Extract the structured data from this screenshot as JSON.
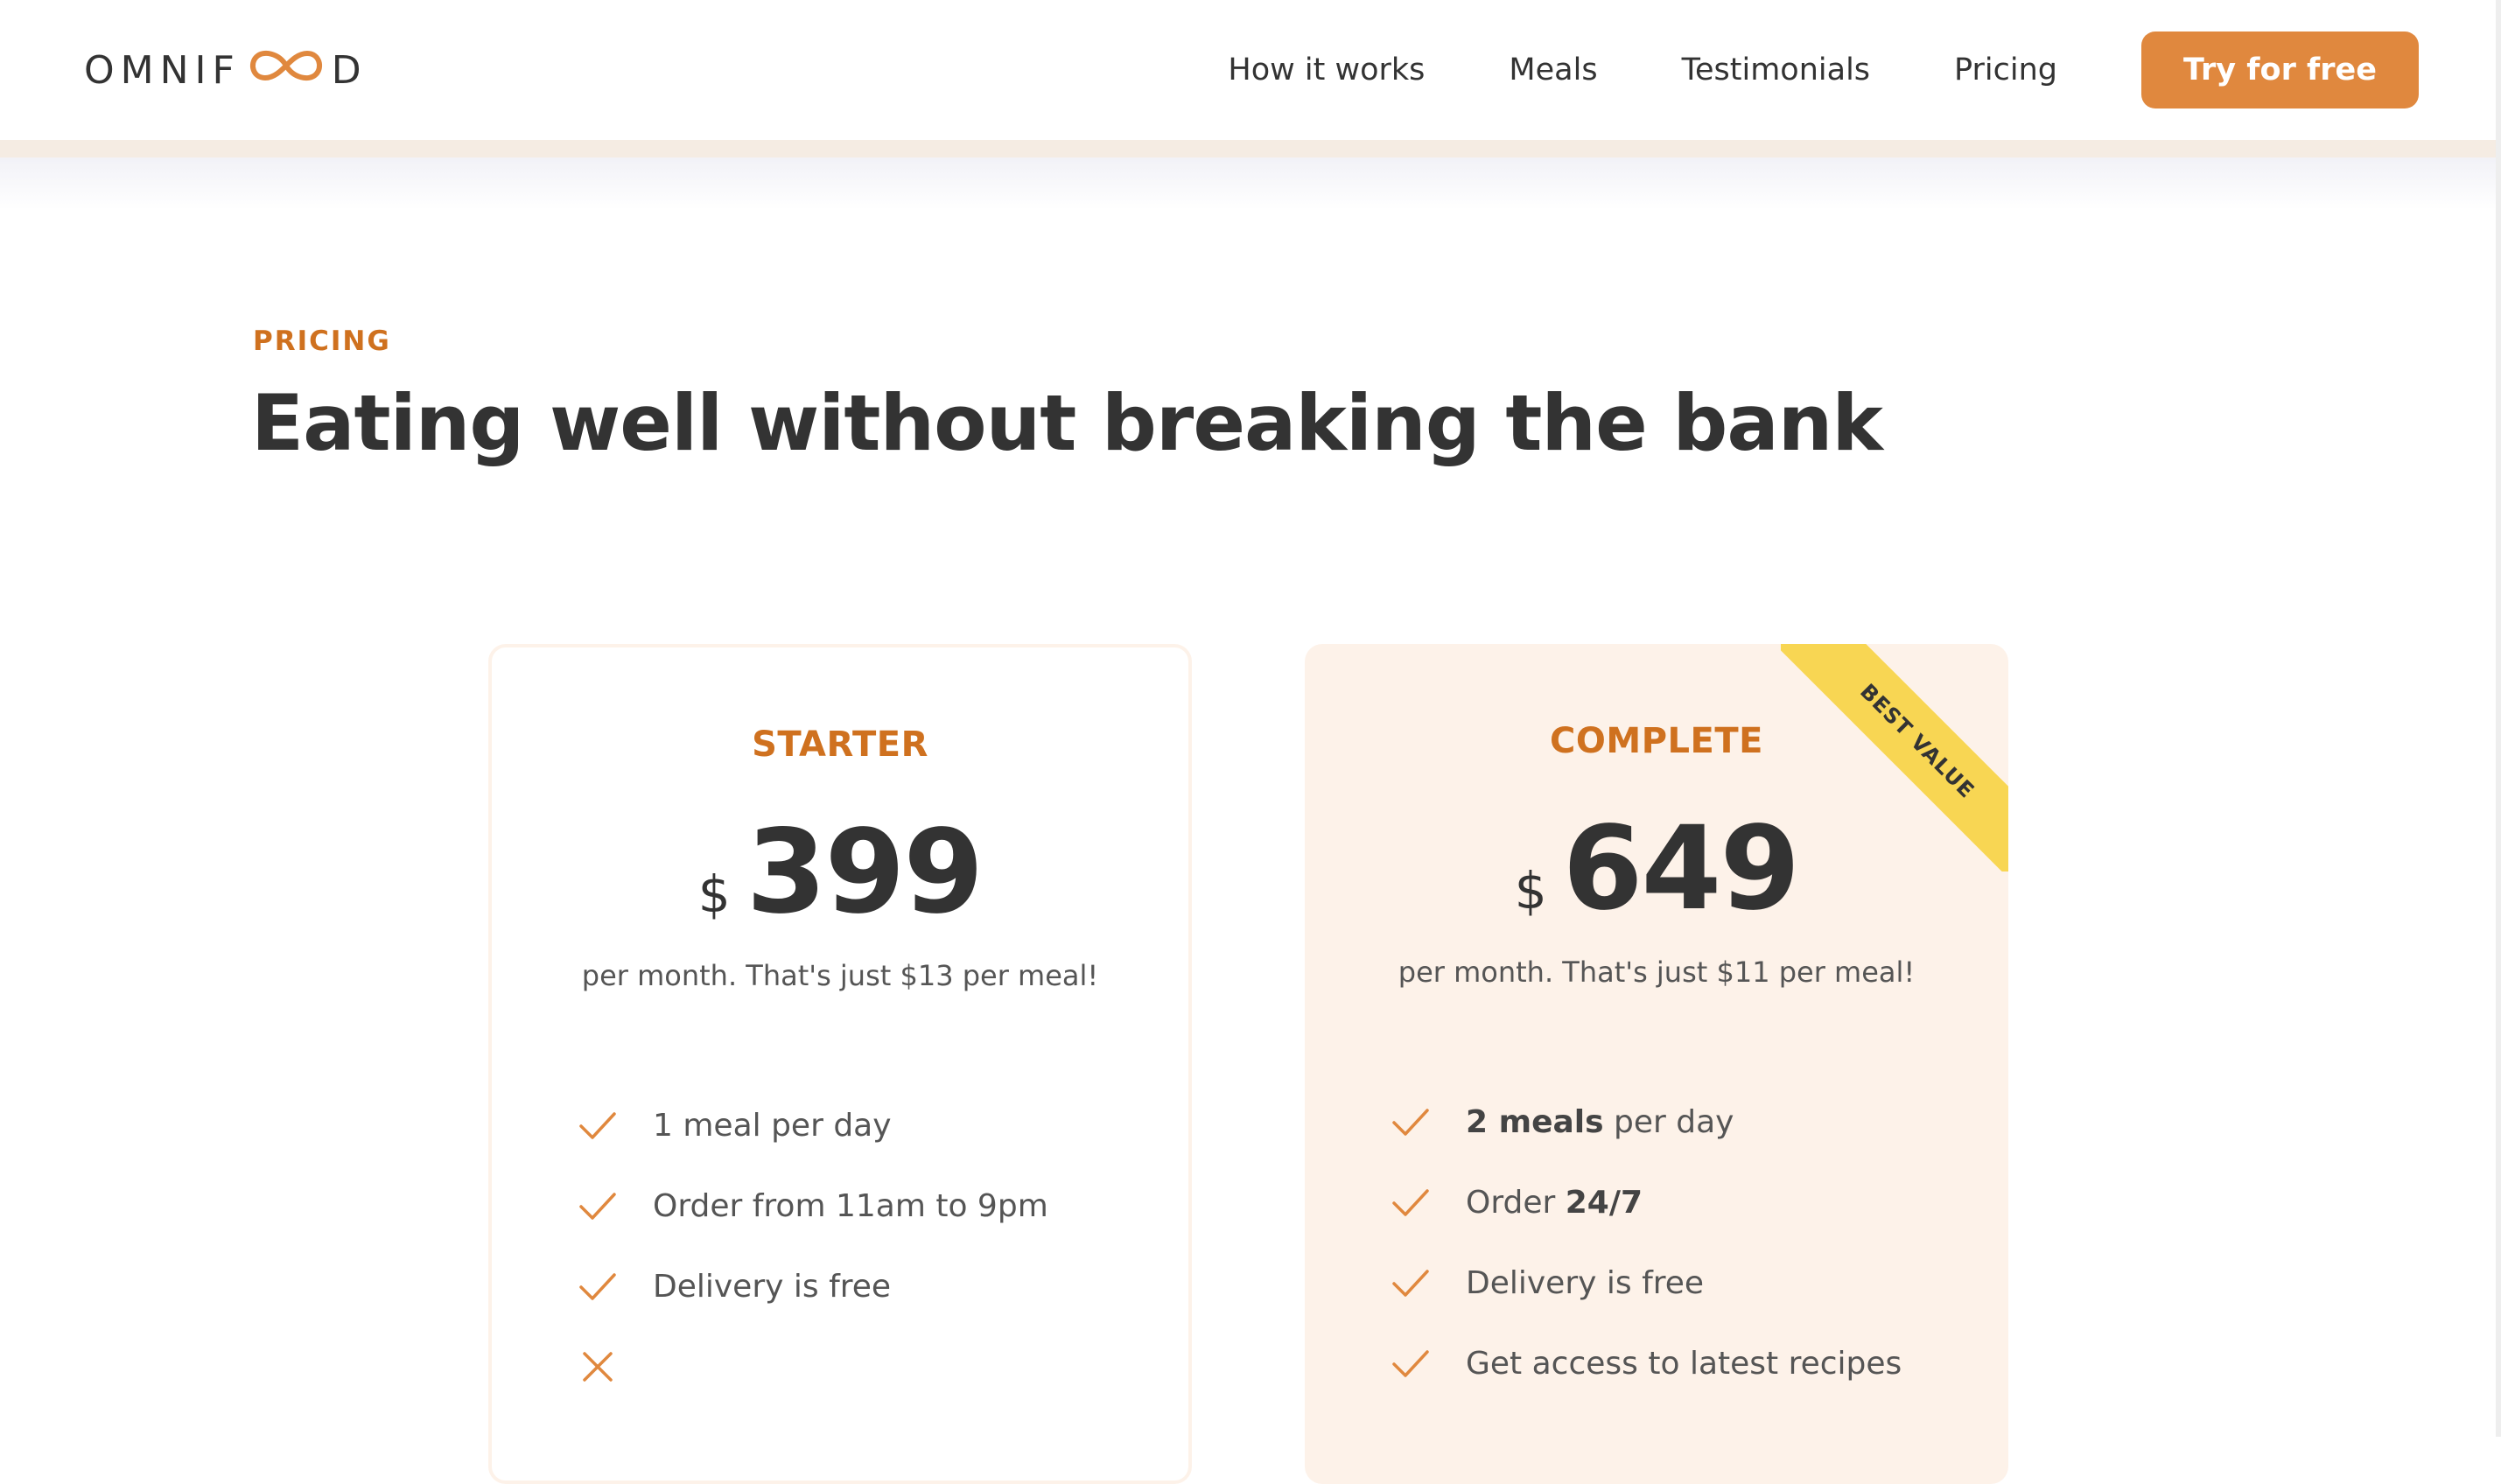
{
  "header": {
    "logo_left": "OMNIF",
    "logo_right": "D",
    "nav": [
      {
        "label": "How it works"
      },
      {
        "label": "Meals"
      },
      {
        "label": "Testimonials"
      },
      {
        "label": "Pricing"
      }
    ],
    "cta_label": "Try for free"
  },
  "section": {
    "eyebrow": "PRICING",
    "title": "Eating well without breaking the bank"
  },
  "plans": [
    {
      "name": "STARTER",
      "currency": "$",
      "price": "399",
      "note": "per month. That's just $13 per meal!",
      "features": [
        {
          "icon": "check-icon",
          "text": "1 meal per day"
        },
        {
          "icon": "check-icon",
          "text": "Order from 11am to 9pm"
        },
        {
          "icon": "check-icon",
          "text": "Delivery is free"
        },
        {
          "icon": "close-icon",
          "text": ""
        }
      ]
    },
    {
      "name": "COMPLETE",
      "currency": "$",
      "price": "649",
      "note": "per month. That's just $11 per meal!",
      "ribbon": "BEST VALUE",
      "features": [
        {
          "icon": "check-icon",
          "bold": "2 meals",
          "text": " per day"
        },
        {
          "icon": "check-icon",
          "text": "Order ",
          "bold_after": "24/7"
        },
        {
          "icon": "check-icon",
          "text": "Delivery is free"
        },
        {
          "icon": "check-icon",
          "text": "Get access to latest recipes"
        }
      ]
    }
  ],
  "colors": {
    "accent": "#e0883e",
    "accent_dark": "#cf711f",
    "highlight_bg": "#fdf2e9",
    "ribbon": "#f8d653"
  }
}
